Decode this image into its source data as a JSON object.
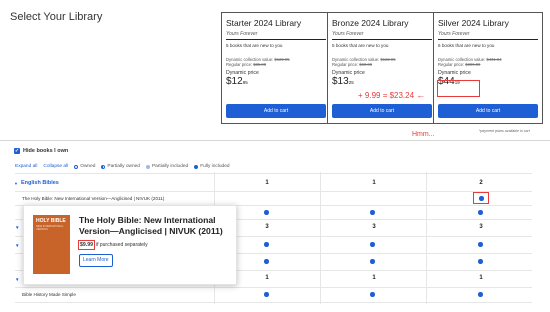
{
  "page_title": "Select Your Library",
  "cards": [
    {
      "name": "Starter 2024 Library",
      "subtitle": "Yours Forever",
      "new_books": "5 books that are new to you",
      "dcv_label": "Dynamic collection value:",
      "dcv_value": "$122.95",
      "regular_label": "Regular price:",
      "regular_value": "$35.00",
      "dynamic_label": "Dynamic price",
      "price_main": "$12",
      "price_cents": "95",
      "cart_label": "Add to cart"
    },
    {
      "name": "Bronze 2024 Library",
      "subtitle": "Yours Forever",
      "new_books": "5 books that are new to you",
      "dcv_label": "Dynamic collection value:",
      "dcv_value": "$122.95",
      "regular_label": "Regular price:",
      "regular_value": "$60.00",
      "dynamic_label": "Dynamic price",
      "price_main": "$13",
      "price_cents": "25",
      "cart_label": "Add to cart"
    },
    {
      "name": "Silver 2024 Library",
      "subtitle": "Yours Forever",
      "new_books": "6 books that are new to you",
      "dcv_label": "Dynamic collection value:",
      "dcv_value": "$431.94",
      "regular_label": "Regular price:",
      "regular_value": "$309.00",
      "dynamic_label": "Dynamic price",
      "price_main": "$44",
      "price_cents": "19",
      "cart_label": "Add to cart"
    }
  ],
  "annotations": {
    "calc": "+ 9.99 = $23.24",
    "arrow": "←",
    "hmm": "Hmm..."
  },
  "footnote": "*payment plans available in cart",
  "hide_books": {
    "label": "Hide books I own",
    "check": "✓"
  },
  "controls": {
    "expand_all": "Expand all",
    "collapse_all": "Collapse all"
  },
  "legend": [
    {
      "label": "Owned",
      "kind": "owned"
    },
    {
      "label": "Partially owned",
      "kind": "partowned"
    },
    {
      "label": "Partially included",
      "kind": "partinc"
    },
    {
      "label": "Fully included",
      "kind": "fully"
    }
  ],
  "sections": [
    {
      "name": "English Bibles",
      "counts": [
        "1",
        "1",
        "2"
      ]
    },
    {
      "name": "",
      "counts": [
        "3",
        "3",
        "3"
      ]
    },
    {
      "name": "",
      "counts": [
        "1",
        "1",
        "1"
      ]
    }
  ],
  "rows": {
    "niv": "The Holy Bible: New International Version—Anglicised | NIVUK (2011)",
    "history": "Bible History Made Simple"
  },
  "caret": "▼",
  "popup": {
    "title": "The Holy Bible: New International Version—Anglicised | NIVUK (2011)",
    "price": "$9.99",
    "price_note": "if purchased separately",
    "learn_more": "Learn More",
    "cover_title": "HOLY BIBLE",
    "cover_sub": "NEW INTERNATIONAL VERSION"
  },
  "colors": {
    "accent": "#1f5fd6",
    "annotation_red": "#e53b3b",
    "cover": "#c8642a"
  }
}
